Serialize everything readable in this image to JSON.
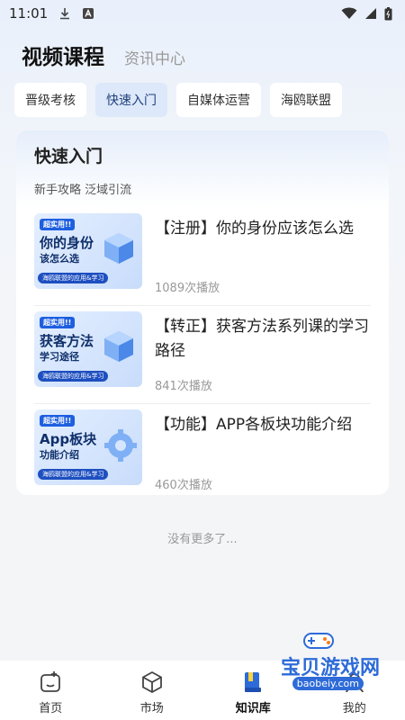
{
  "status_bar": {
    "time": "11:01"
  },
  "header": {
    "tabs": [
      "视频课程",
      "资讯中心"
    ]
  },
  "chips": [
    "晋级考核",
    "快速入门",
    "自媒体运营",
    "海鸥联盟"
  ],
  "card": {
    "title": "快速入门",
    "subtitle": "新手攻略 泛域引流",
    "courses": [
      {
        "title": "【注册】你的身份应该怎么选",
        "plays": "1089次播放",
        "thumb": {
          "tag": "超实用!!",
          "line1": "你的身份",
          "line2": "该怎么选",
          "foot": "海鸥联盟的应用&学习"
        }
      },
      {
        "title": "【转正】获客方法系列课的学习路径",
        "plays": "841次播放",
        "thumb": {
          "tag": "超实用!!",
          "line1": "获客方法",
          "line2": "学习途径",
          "foot": "海鸥联盟的应用&学习"
        }
      },
      {
        "title": "【功能】APP各板块功能介绍",
        "plays": "460次播放",
        "thumb": {
          "tag": "超实用!!",
          "line1": "App板块",
          "line2": "功能介绍",
          "foot": "海鸥联盟的应用&学习"
        }
      }
    ]
  },
  "no_more": "没有更多了...",
  "bottom_nav": [
    "首页",
    "市场",
    "知识库",
    "我的"
  ],
  "watermark": {
    "text": "宝贝游戏网",
    "url": "baobeiy.com"
  },
  "colors": {
    "accent": "#2e6bd8",
    "chip_active_bg": "#dde8fa"
  }
}
